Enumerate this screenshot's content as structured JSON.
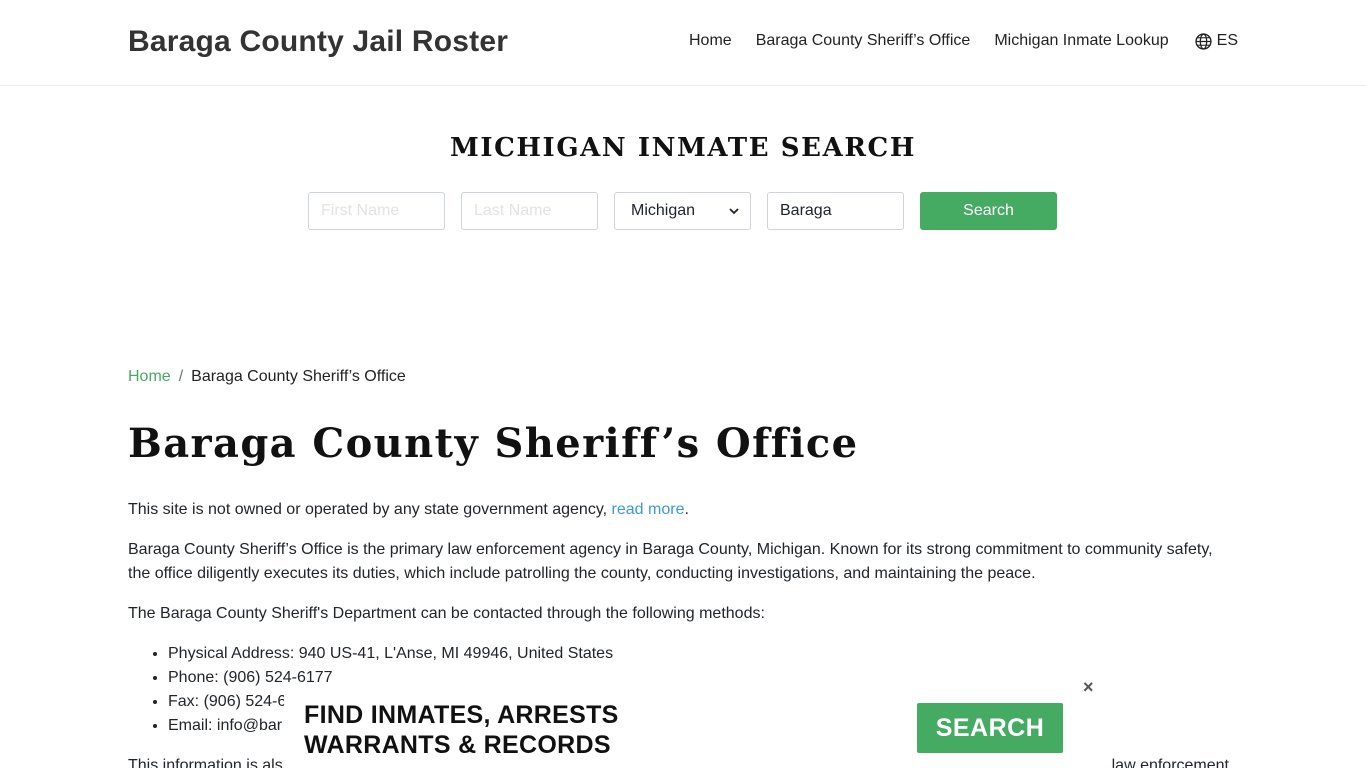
{
  "header": {
    "brand": "Baraga County Jail Roster",
    "nav": [
      "Home",
      "Baraga County Sheriff’s Office",
      "Michigan Inmate Lookup"
    ],
    "lang": "ES"
  },
  "search": {
    "title": "MICHIGAN INMATE SEARCH",
    "first_name_placeholder": "First Name",
    "last_name_placeholder": "Last Name",
    "state_value": "Michigan",
    "county_value": "Baraga",
    "button": "Search"
  },
  "breadcrumb": {
    "home": "Home",
    "separator": "/",
    "current": "Baraga County Sheriff’s Office"
  },
  "main": {
    "title": "Baraga County Sheriff’s Office",
    "disclaimer": "This site is not owned or operated by any state government agency,",
    "disclaimer_link": "read more",
    "disclaimer_end": ".",
    "para1": "Baraga County Sheriff’s Office is the primary law enforcement agency in Baraga County, Michigan. Known for its strong commitment to community safety, the office diligently executes its duties, which include patrolling the county, conducting investigations, and maintaining the peace.",
    "para2": "The Baraga County Sheriff's Department can be contacted through the following methods:",
    "contacts": [
      "Physical Address: 940 US-41, L'Anse, MI 49946, United States",
      "Phone: (906) 524-6177",
      "Fax: (906) 524-6",
      "Email: info@bar"
    ],
    "para3_start": "This information is als",
    "para3_end": "ocal law enforcement"
  },
  "ad": {
    "line1": "FIND INMATES, ARRESTS",
    "line2": "WARRANTS & RECORDS",
    "button": "SEARCH",
    "close": "×"
  },
  "colors": {
    "accent_green": "#46ab62",
    "link_blue": "#3a9bd6"
  }
}
